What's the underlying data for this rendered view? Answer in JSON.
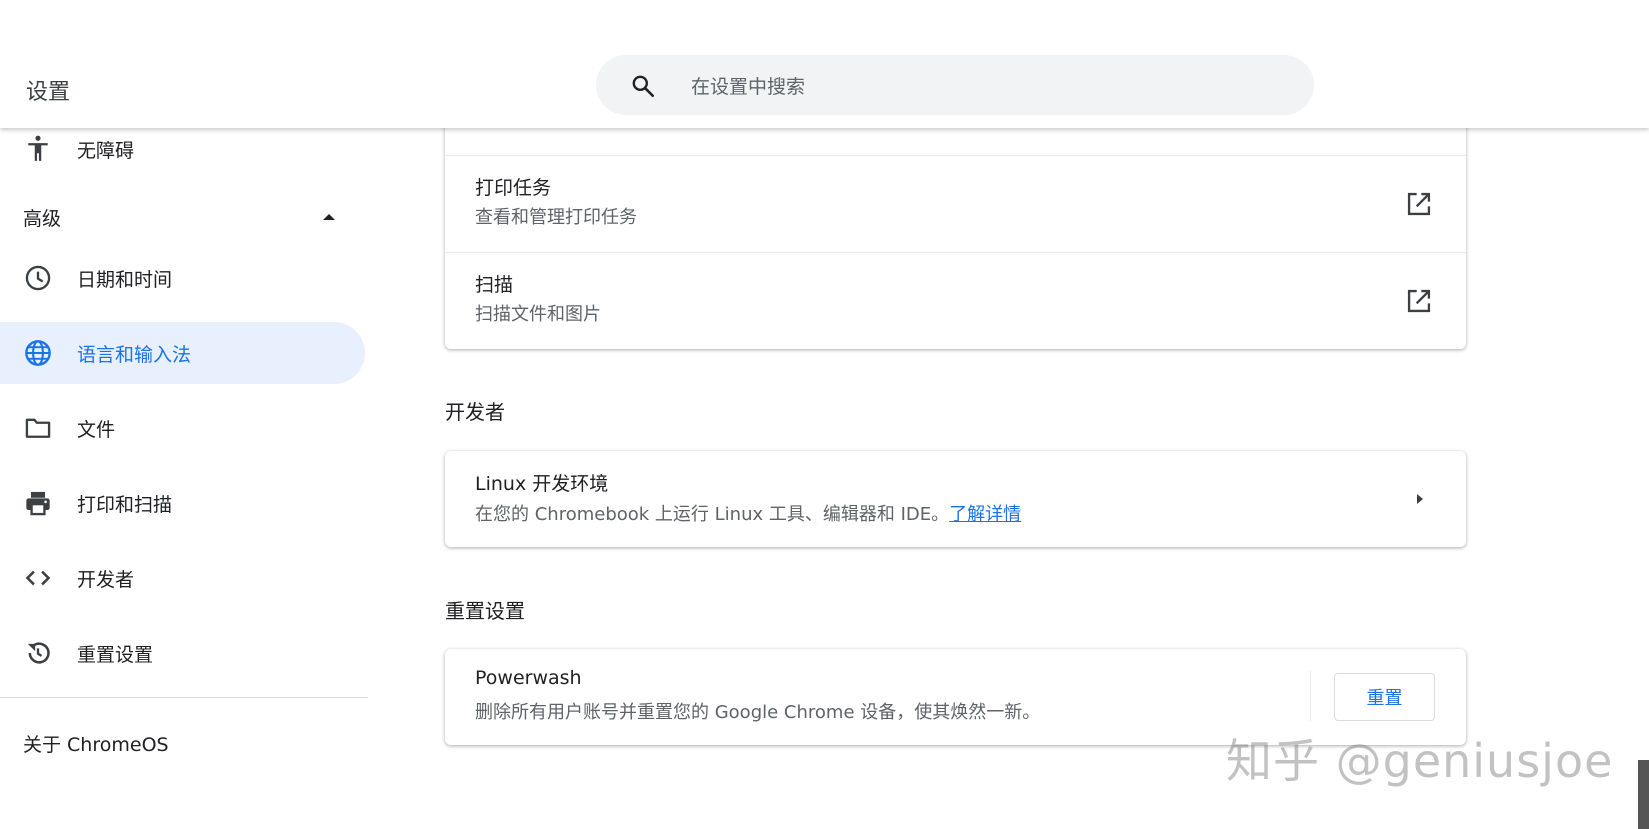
{
  "window": {
    "minimize_icon": "minimize-icon",
    "maximize_icon": "maximize-icon",
    "close_icon": "close-icon"
  },
  "header": {
    "title": "设置",
    "search_placeholder": "在设置中搜索"
  },
  "sidebar": {
    "items": [
      {
        "label": "无障碍",
        "icon": "accessibility-icon"
      },
      {
        "label": "日期和时间",
        "icon": "clock-icon"
      },
      {
        "label": "语言和输入法",
        "icon": "globe-icon",
        "selected": true
      },
      {
        "label": "文件",
        "icon": "folder-icon"
      },
      {
        "label": "打印和扫描",
        "icon": "printer-icon"
      },
      {
        "label": "开发者",
        "icon": "code-icon"
      },
      {
        "label": "重置设置",
        "icon": "restore-icon"
      }
    ],
    "advanced_label": "高级",
    "about_label": "关于 ChromeOS"
  },
  "main": {
    "print_card": {
      "rows": [
        {
          "title": "打印任务",
          "subtitle": "查看和管理打印任务"
        },
        {
          "title": "扫描",
          "subtitle": "扫描文件和图片"
        }
      ]
    },
    "developer": {
      "section_title": "开发者",
      "row_title": "Linux 开发环境",
      "row_subtitle": "在您的 Chromebook 上运行 Linux 工具、编辑器和 IDE。",
      "learn_more": "了解详情"
    },
    "reset": {
      "section_title": "重置设置",
      "row_title": "Powerwash",
      "row_subtitle": "删除所有用户账号并重置您的 Google Chrome 设备，使其焕然一新。",
      "button_label": "重置"
    }
  },
  "watermark": "知乎 @geniusjoe",
  "colors": {
    "accent": "#1a73e8",
    "selected_bg": "#e8f0fe",
    "search_bg": "#f1f3f4"
  }
}
